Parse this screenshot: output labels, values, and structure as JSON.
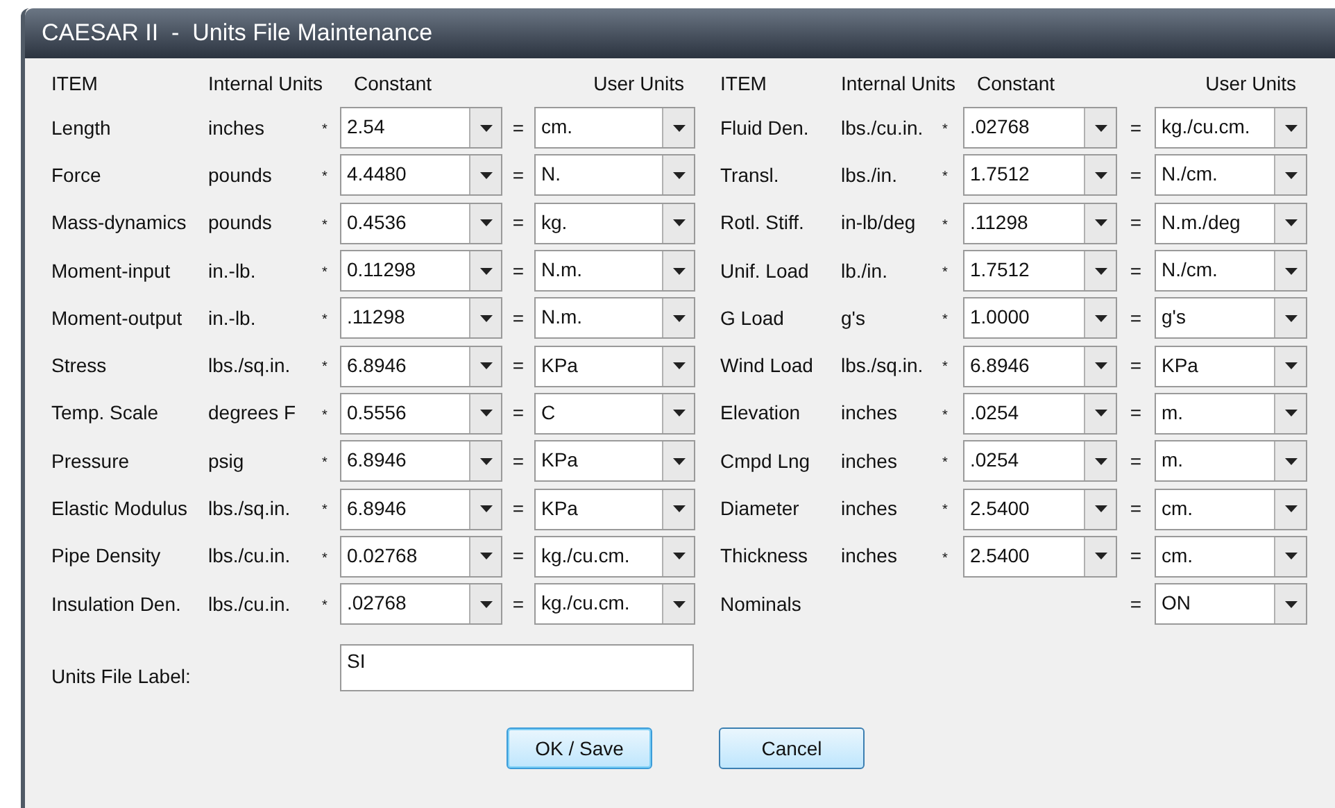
{
  "window": {
    "title": "CAESAR II  -  Units File Maintenance"
  },
  "headers": [
    {
      "item": "ITEM",
      "internal": "Internal Units",
      "constant": "Constant",
      "user": "User Units"
    },
    {
      "item": "ITEM",
      "internal": "Internal Units",
      "constant": "Constant",
      "user": "User Units"
    }
  ],
  "columns": [
    [
      {
        "kind": "conversion",
        "item": "Length",
        "internal": "inches",
        "times": "*",
        "constant": "2.54",
        "equals": "=",
        "user": "cm."
      },
      {
        "kind": "conversion",
        "item": "Force",
        "internal": "pounds",
        "times": "*",
        "constant": "4.4480",
        "equals": "=",
        "user": "N."
      },
      {
        "kind": "conversion",
        "item": "Mass-dynamics",
        "internal": "pounds",
        "times": "*",
        "constant": "0.4536",
        "equals": "=",
        "user": "kg."
      },
      {
        "kind": "conversion",
        "item": "Moment-input",
        "internal": "in.-lb.",
        "times": "*",
        "constant": "0.11298",
        "equals": "=",
        "user": "N.m."
      },
      {
        "kind": "conversion",
        "item": "Moment-output",
        "internal": "in.-lb.",
        "times": "*",
        "constant": ".11298",
        "equals": "=",
        "user": "N.m."
      },
      {
        "kind": "conversion",
        "item": "Stress",
        "internal": "lbs./sq.in.",
        "times": "*",
        "constant": "6.8946",
        "equals": "=",
        "user": "KPa"
      },
      {
        "kind": "conversion",
        "item": "Temp. Scale",
        "internal": "degrees F",
        "times": "*",
        "constant": "0.5556",
        "equals": "=",
        "user": "C"
      },
      {
        "kind": "conversion",
        "item": "Pressure",
        "internal": "psig",
        "times": "*",
        "constant": "6.8946",
        "equals": "=",
        "user": "KPa"
      },
      {
        "kind": "conversion",
        "item": "Elastic Modulus",
        "internal": "lbs./sq.in.",
        "times": "*",
        "constant": "6.8946",
        "equals": "=",
        "user": "KPa"
      },
      {
        "kind": "conversion",
        "item": "Pipe Density",
        "internal": "lbs./cu.in.",
        "times": "*",
        "constant": "0.02768",
        "equals": "=",
        "user": "kg./cu.cm."
      },
      {
        "kind": "conversion",
        "item": "Insulation Den.",
        "internal": "lbs./cu.in.",
        "times": "*",
        "constant": ".02768",
        "equals": "=",
        "user": "kg./cu.cm."
      }
    ],
    [
      {
        "kind": "conversion",
        "item": "Fluid Den.",
        "internal": "lbs./cu.in.",
        "times": "*",
        "constant": ".02768",
        "equals": "=",
        "user": "kg./cu.cm."
      },
      {
        "kind": "conversion",
        "item": "Transl.",
        "internal": "lbs./in.",
        "times": "*",
        "constant": "1.7512",
        "equals": "=",
        "user": "N./cm."
      },
      {
        "kind": "conversion",
        "item": "Rotl. Stiff.",
        "internal": "in-lb/deg",
        "times": "*",
        "constant": ".11298",
        "equals": "=",
        "user": "N.m./deg"
      },
      {
        "kind": "conversion",
        "item": "Unif. Load",
        "internal": "lb./in.",
        "times": "*",
        "constant": "1.7512",
        "equals": "=",
        "user": "N./cm."
      },
      {
        "kind": "conversion",
        "item": "G Load",
        "internal": "g's",
        "times": "*",
        "constant": "1.0000",
        "equals": "=",
        "user": "g's"
      },
      {
        "kind": "conversion",
        "item": "Wind Load",
        "internal": "lbs./sq.in.",
        "times": "*",
        "constant": "6.8946",
        "equals": "=",
        "user": "KPa"
      },
      {
        "kind": "conversion",
        "item": "Elevation",
        "internal": "inches",
        "times": "*",
        "constant": ".0254",
        "equals": "=",
        "user": "m."
      },
      {
        "kind": "conversion",
        "item": "Cmpd Lng",
        "internal": "inches",
        "times": "*",
        "constant": ".0254",
        "equals": "=",
        "user": "m."
      },
      {
        "kind": "conversion",
        "item": "Diameter",
        "internal": "inches",
        "times": "*",
        "constant": "2.5400",
        "equals": "=",
        "user": "cm."
      },
      {
        "kind": "conversion",
        "item": "Thickness",
        "internal": "inches",
        "times": "*",
        "constant": "2.5400",
        "equals": "=",
        "user": "cm."
      },
      {
        "kind": "setting",
        "item": "Nominals",
        "equals": "=",
        "user": "ON"
      }
    ]
  ],
  "label_field": {
    "label": "Units File Label:",
    "value": "SI"
  },
  "buttons": [
    {
      "label": "OK / Save",
      "default": true
    },
    {
      "label": "Cancel",
      "default": false
    }
  ]
}
